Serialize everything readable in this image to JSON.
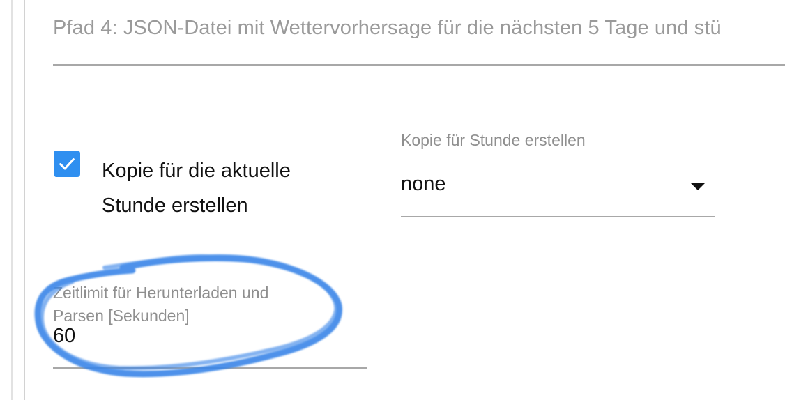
{
  "path_field": {
    "label": "Pfad 4: JSON-Datei mit Wettervorhersage für die nächsten 5 Tage und stü"
  },
  "checkbox": {
    "checked": true,
    "label": "Kopie für die aktuelle Stunde erstellen"
  },
  "select": {
    "label": "Kopie für Stunde erstellen",
    "value": "none"
  },
  "timeout": {
    "label": "Zeitlimit für Herunterladen und Parsen [Sekunden]",
    "value": "60"
  },
  "colors": {
    "accent": "#2f8ff0",
    "annotation": "#3a86e8"
  },
  "icons": {
    "checkbox": "check-icon",
    "select": "dropdown-arrow-icon"
  }
}
